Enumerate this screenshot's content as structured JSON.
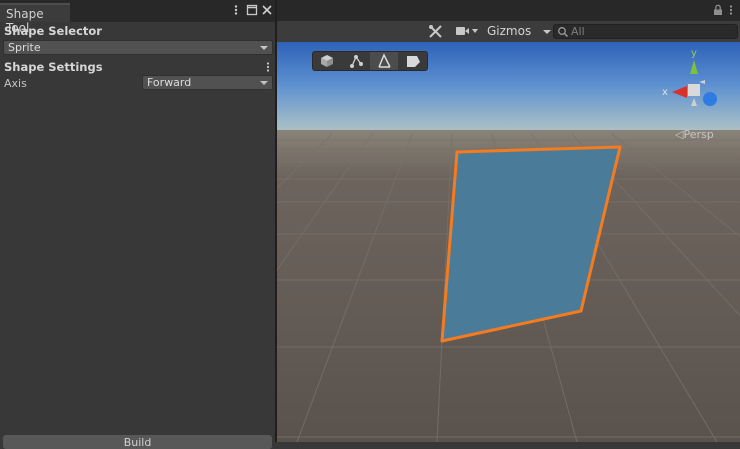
{
  "panel": {
    "tab_title": "Shape Tool",
    "shape_selector": {
      "header": "Shape Selector",
      "value": "Sprite"
    },
    "shape_settings": {
      "header": "Shape Settings",
      "axis_label": "Axis",
      "axis_value": "Forward"
    },
    "build_button_label": "Build"
  },
  "scene": {
    "toolbar": {
      "gizmos_label": "Gizmos",
      "search_placeholder": "All"
    },
    "axis_gizmo": {
      "x_label": "x",
      "y_label": "y",
      "projection_label": "Persp"
    }
  },
  "colors": {
    "panel_bg": "#383838",
    "selection_outline": "#f47b20",
    "quad_fill": "#4a7c9a",
    "sky_top": "#2e62b8",
    "ground": "#5e5650"
  },
  "icons": [
    "more-vert-icon",
    "maximize-icon",
    "close-icon",
    "lock-icon",
    "tools-icon",
    "camera-icon",
    "search-icon",
    "cube-icon",
    "edit-vertices-icon",
    "edit-edges-icon",
    "edit-faces-icon"
  ]
}
